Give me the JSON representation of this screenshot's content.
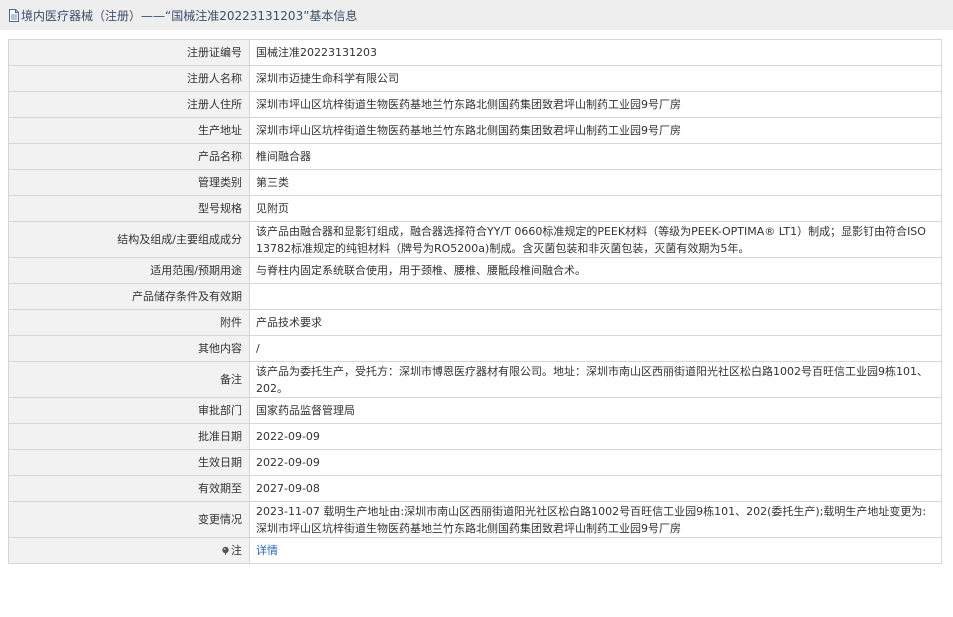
{
  "header": {
    "title": "境内医疗器械（注册）——“国械注准20223131203”基本信息"
  },
  "rows": [
    {
      "label": "注册证编号",
      "value": "国械注准20223131203"
    },
    {
      "label": "注册人名称",
      "value": "深圳市迈捷生命科学有限公司"
    },
    {
      "label": "注册人住所",
      "value": "深圳市坪山区坑梓街道生物医药基地兰竹东路北侧国药集团致君坪山制药工业园9号厂房"
    },
    {
      "label": "生产地址",
      "value": "深圳市坪山区坑梓街道生物医药基地兰竹东路北侧国药集团致君坪山制药工业园9号厂房"
    },
    {
      "label": "产品名称",
      "value": "椎间融合器"
    },
    {
      "label": "管理类别",
      "value": "第三类"
    },
    {
      "label": "型号规格",
      "value": "见附页"
    },
    {
      "label": "结构及组成/主要组成成分",
      "value": "该产品由融合器和显影钉组成，融合器选择符合YY/T 0660标准规定的PEEK材料（等级为PEEK-OPTIMA® LT1）制成；显影钉由符合ISO 13782标准规定的纯钽材料（牌号为RO5200a)制成。含灭菌包装和非灭菌包装，灭菌有效期为5年。"
    },
    {
      "label": "适用范围/预期用途",
      "value": "与脊柱内固定系统联合使用，用于颈椎、腰椎、腰骶段椎间融合术。"
    },
    {
      "label": "产品储存条件及有效期",
      "value": ""
    },
    {
      "label": "附件",
      "value": "产品技术要求"
    },
    {
      "label": "其他内容",
      "value": "/"
    },
    {
      "label": "备注",
      "value": "该产品为委托生产，受托方：深圳市博恩医疗器材有限公司。地址：深圳市南山区西丽街道阳光社区松白路1002号百旺信工业园9栋101、202。"
    },
    {
      "label": "审批部门",
      "value": "国家药品监督管理局"
    },
    {
      "label": "批准日期",
      "value": "2022-09-09"
    },
    {
      "label": "生效日期",
      "value": "2022-09-09"
    },
    {
      "label": "有效期至",
      "value": "2027-09-08"
    },
    {
      "label": "变更情况",
      "value": "2023-11-07 载明生产地址由:深圳市南山区西丽街道阳光社区松白路1002号百旺信工业园9栋101、202(委托生产);载明生产地址变更为:深圳市坪山区坑梓街道生物医药基地兰竹东路北侧国药集团致君坪山制药工业园9号厂房"
    }
  ],
  "note": {
    "label": "注",
    "link": "详情"
  },
  "colors": {
    "header_bg": "#eeeeee",
    "label_bg": "#f2f2f2",
    "border": "#d6d6d6",
    "link": "#2a66b8"
  }
}
